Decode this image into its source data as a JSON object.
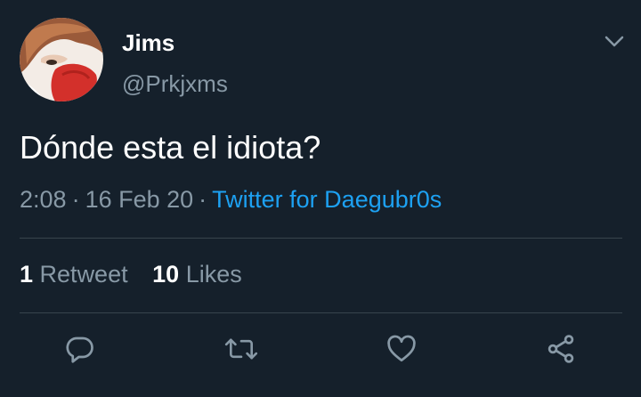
{
  "author": {
    "display_name": "Jims",
    "handle": "@Prkjxms"
  },
  "tweet": {
    "text": "Dónde esta el idiota?",
    "time": "2:08",
    "date": "16 Feb 20",
    "separator": "·",
    "source": "Twitter for Daegubr0s"
  },
  "stats": {
    "retweets_count": "1",
    "retweets_label": "Retweet",
    "likes_count": "10",
    "likes_label": "Likes"
  },
  "actions": [
    {
      "icon": "reply-icon"
    },
    {
      "icon": "retweet-icon"
    },
    {
      "icon": "like-icon"
    },
    {
      "icon": "share-icon"
    }
  ],
  "colors": {
    "background": "#15202b",
    "primary_text": "#ffffff",
    "secondary_text": "#8899a6",
    "accent": "#1da1f2",
    "divider": "#38444d"
  }
}
